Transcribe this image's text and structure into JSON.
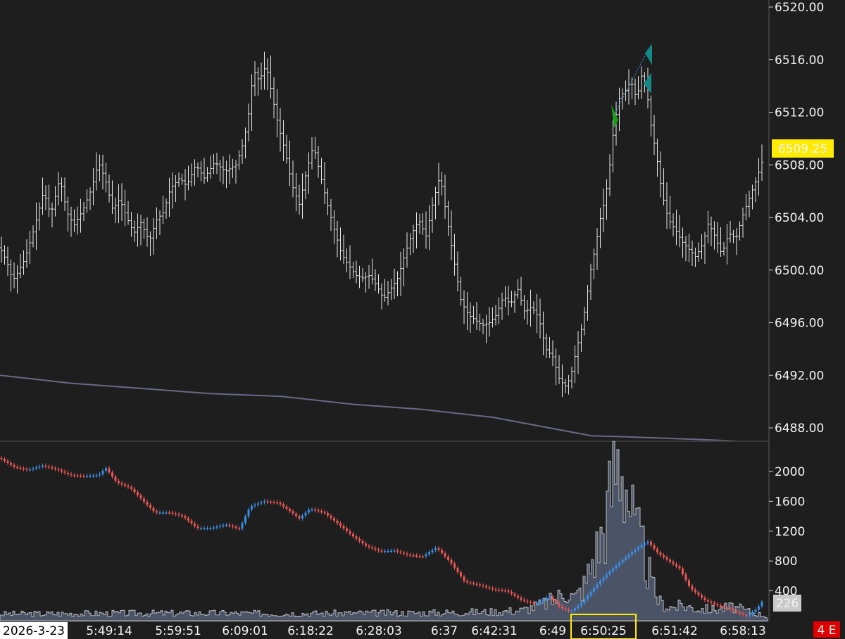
{
  "chart_data": [
    {
      "type": "ohlc",
      "panel": "price",
      "y_ticks": [
        "6520.00",
        "6516.00",
        "6512.00",
        "6508.00",
        "6504.00",
        "6500.00",
        "6496.00",
        "6492.00",
        "6488.00"
      ],
      "ylim": [
        6487,
        6520.5
      ],
      "last_price_label": "6509.25",
      "close_path": [
        [
          0,
          6501.7
        ],
        [
          10,
          6500.6
        ],
        [
          18,
          6499.2
        ],
        [
          25,
          6499.8
        ],
        [
          35,
          6500.8
        ],
        [
          45,
          6502.5
        ],
        [
          55,
          6504.5
        ],
        [
          62,
          6506.0
        ],
        [
          72,
          6504.2
        ],
        [
          85,
          6507.0
        ],
        [
          95,
          6504.4
        ],
        [
          105,
          6503.4
        ],
        [
          118,
          6504.6
        ],
        [
          130,
          6506.2
        ],
        [
          140,
          6508.2
        ],
        [
          150,
          6506.8
        ],
        [
          160,
          6504.6
        ],
        [
          170,
          6505.4
        ],
        [
          180,
          6504.0
        ],
        [
          190,
          6502.8
        ],
        [
          200,
          6503.6
        ],
        [
          212,
          6502.2
        ],
        [
          222,
          6503.8
        ],
        [
          232,
          6504.4
        ],
        [
          242,
          6506.2
        ],
        [
          255,
          6507.0
        ],
        [
          265,
          6506.4
        ],
        [
          278,
          6508.0
        ],
        [
          290,
          6507.0
        ],
        [
          305,
          6508.2
        ],
        [
          320,
          6507.5
        ],
        [
          335,
          6508.0
        ],
        [
          345,
          6509.6
        ],
        [
          352,
          6511.4
        ],
        [
          360,
          6515.2
        ],
        [
          368,
          6514.4
        ],
        [
          378,
          6515.6
        ],
        [
          386,
          6513.4
        ],
        [
          395,
          6511.0
        ],
        [
          405,
          6509.0
        ],
        [
          415,
          6506.4
        ],
        [
          425,
          6505.0
        ],
        [
          435,
          6507.4
        ],
        [
          445,
          6509.5
        ],
        [
          455,
          6507.2
        ],
        [
          465,
          6505.0
        ],
        [
          475,
          6503.0
        ],
        [
          485,
          6501.2
        ],
        [
          495,
          6500.4
        ],
        [
          505,
          6499.6
        ],
        [
          515,
          6499.4
        ],
        [
          525,
          6499.6
        ],
        [
          535,
          6498.8
        ],
        [
          545,
          6497.8
        ],
        [
          555,
          6498.6
        ],
        [
          565,
          6499.4
        ],
        [
          575,
          6501.2
        ],
        [
          585,
          6502.8
        ],
        [
          595,
          6503.8
        ],
        [
          605,
          6502.6
        ],
        [
          615,
          6505.2
        ],
        [
          625,
          6507.2
        ],
        [
          635,
          6503.8
        ],
        [
          645,
          6500.6
        ],
        [
          655,
          6497.6
        ],
        [
          665,
          6496.6
        ],
        [
          675,
          6496.2
        ],
        [
          685,
          6495.8
        ],
        [
          695,
          6496.0
        ],
        [
          705,
          6496.6
        ],
        [
          715,
          6498.0
        ],
        [
          725,
          6497.4
        ],
        [
          735,
          6498.6
        ],
        [
          745,
          6496.8
        ],
        [
          755,
          6497.2
        ],
        [
          765,
          6496.4
        ],
        [
          775,
          6494.0
        ],
        [
          785,
          6493.4
        ],
        [
          795,
          6491.6
        ],
        [
          803,
          6491.2
        ],
        [
          810,
          6491.8
        ],
        [
          818,
          6493.8
        ],
        [
          826,
          6495.6
        ],
        [
          832,
          6497.4
        ],
        [
          838,
          6499.8
        ],
        [
          845,
          6501.6
        ],
        [
          852,
          6503.8
        ],
        [
          860,
          6505.6
        ],
        [
          866,
          6508.0
        ],
        [
          872,
          6511.0
        ],
        [
          880,
          6513.2
        ],
        [
          888,
          6513.6
        ],
        [
          896,
          6514.4
        ],
        [
          904,
          6513.0
        ],
        [
          912,
          6515.0
        ],
        [
          918,
          6513.8
        ],
        [
          925,
          6510.8
        ],
        [
          932,
          6508.8
        ],
        [
          938,
          6506.6
        ],
        [
          945,
          6504.6
        ],
        [
          952,
          6503.6
        ],
        [
          960,
          6503.0
        ],
        [
          968,
          6502.2
        ],
        [
          978,
          6501.6
        ],
        [
          988,
          6501.0
        ],
        [
          998,
          6502.0
        ],
        [
          1006,
          6503.6
        ],
        [
          1015,
          6502.6
        ],
        [
          1025,
          6501.2
        ],
        [
          1035,
          6502.8
        ],
        [
          1045,
          6502.4
        ],
        [
          1055,
          6504.2
        ],
        [
          1065,
          6505.6
        ],
        [
          1075,
          6507.0
        ],
        [
          1082,
          6508.2
        ],
        [
          1087,
          6509.25
        ]
      ],
      "moving_average": [
        [
          0,
          6492.0
        ],
        [
          100,
          6491.4
        ],
        [
          200,
          6491.0
        ],
        [
          300,
          6490.6
        ],
        [
          400,
          6490.4
        ],
        [
          500,
          6489.8
        ],
        [
          600,
          6489.4
        ],
        [
          700,
          6488.8
        ],
        [
          780,
          6488.0
        ],
        [
          840,
          6487.4
        ],
        [
          900,
          6487.3
        ],
        [
          1000,
          6487.1
        ],
        [
          1045,
          6487.0
        ]
      ]
    },
    {
      "type": "line",
      "panel": "indicator",
      "y_ticks": [
        "2000",
        "1600",
        "1200",
        "800",
        "400"
      ],
      "ylim": [
        0,
        2320
      ],
      "last_value_label": "226",
      "histogram_path": [
        [
          0,
          90
        ],
        [
          100,
          95
        ],
        [
          200,
          100
        ],
        [
          300,
          100
        ],
        [
          400,
          95
        ],
        [
          500,
          100
        ],
        [
          600,
          105
        ],
        [
          640,
          110
        ],
        [
          700,
          120
        ],
        [
          740,
          140
        ],
        [
          770,
          220
        ],
        [
          790,
          300
        ],
        [
          800,
          420
        ],
        [
          815,
          300
        ],
        [
          830,
          500
        ],
        [
          840,
          820
        ],
        [
          848,
          1000
        ],
        [
          855,
          1200
        ],
        [
          862,
          1500
        ],
        [
          868,
          1850
        ],
        [
          874,
          2150
        ],
        [
          880,
          2250
        ],
        [
          886,
          2000
        ],
        [
          892,
          1650
        ],
        [
          898,
          1300
        ],
        [
          904,
          1100
        ],
        [
          910,
          1000
        ],
        [
          918,
          720
        ],
        [
          925,
          450
        ],
        [
          935,
          250
        ],
        [
          950,
          180
        ],
        [
          970,
          200
        ],
        [
          990,
          160
        ],
        [
          1010,
          150
        ],
        [
          1040,
          180
        ],
        [
          1060,
          130
        ],
        [
          1075,
          90
        ],
        [
          1087,
          60
        ]
      ],
      "line_path": [
        [
          0,
          2180
        ],
        [
          20,
          2060
        ],
        [
          40,
          2020
        ],
        [
          60,
          2080
        ],
        [
          80,
          2030
        ],
        [
          100,
          1950
        ],
        [
          120,
          1940
        ],
        [
          140,
          1950
        ],
        [
          150,
          2050
        ],
        [
          165,
          1860
        ],
        [
          185,
          1780
        ],
        [
          205,
          1590
        ],
        [
          220,
          1450
        ],
        [
          240,
          1450
        ],
        [
          260,
          1400
        ],
        [
          280,
          1240
        ],
        [
          300,
          1240
        ],
        [
          320,
          1290
        ],
        [
          340,
          1230
        ],
        [
          355,
          1530
        ],
        [
          375,
          1600
        ],
        [
          395,
          1580
        ],
        [
          410,
          1480
        ],
        [
          425,
          1370
        ],
        [
          440,
          1500
        ],
        [
          460,
          1450
        ],
        [
          480,
          1300
        ],
        [
          500,
          1140
        ],
        [
          520,
          1000
        ],
        [
          540,
          930
        ],
        [
          560,
          940
        ],
        [
          580,
          880
        ],
        [
          600,
          860
        ],
        [
          620,
          980
        ],
        [
          640,
          780
        ],
        [
          660,
          520
        ],
        [
          680,
          480
        ],
        [
          700,
          420
        ],
        [
          720,
          400
        ],
        [
          740,
          280
        ],
        [
          760,
          220
        ],
        [
          780,
          330
        ],
        [
          795,
          180
        ],
        [
          810,
          120
        ],
        [
          825,
          230
        ],
        [
          840,
          400
        ],
        [
          855,
          560
        ],
        [
          870,
          700
        ],
        [
          885,
          820
        ],
        [
          900,
          940
        ],
        [
          912,
          1020
        ],
        [
          920,
          1060
        ],
        [
          935,
          900
        ],
        [
          950,
          800
        ],
        [
          965,
          700
        ],
        [
          980,
          440
        ],
        [
          1000,
          280
        ],
        [
          1020,
          200
        ],
        [
          1040,
          140
        ],
        [
          1060,
          60
        ],
        [
          1075,
          160
        ],
        [
          1087,
          320
        ]
      ]
    }
  ],
  "time_axis": {
    "labels": [
      "2026-3-23",
      "5:49:14",
      "5:59:51",
      "6:09:01",
      "6:18:22",
      "6:28:03",
      "6:37",
      "6:42:31",
      "6:49",
      "6:50:25",
      "6:51:42",
      "6:58:13"
    ],
    "highlighted_label": "6:50:25"
  },
  "corner_badge": "4 E",
  "colors": {
    "background": "#1e1e1e",
    "bar": "#e6e6e6",
    "moving_average": "#6a6888",
    "histogram_fill": "#4b5467",
    "histogram_stroke": "#b9bcc4",
    "candle_up": "#3a8ee6",
    "candle_down": "#ea5555",
    "last_price_bg": "#ffeb00",
    "highlight_border": "#ffeb00",
    "badge_bg": "#e00000",
    "marker_green": "#1a9e1a",
    "marker_teal": "#138888"
  }
}
